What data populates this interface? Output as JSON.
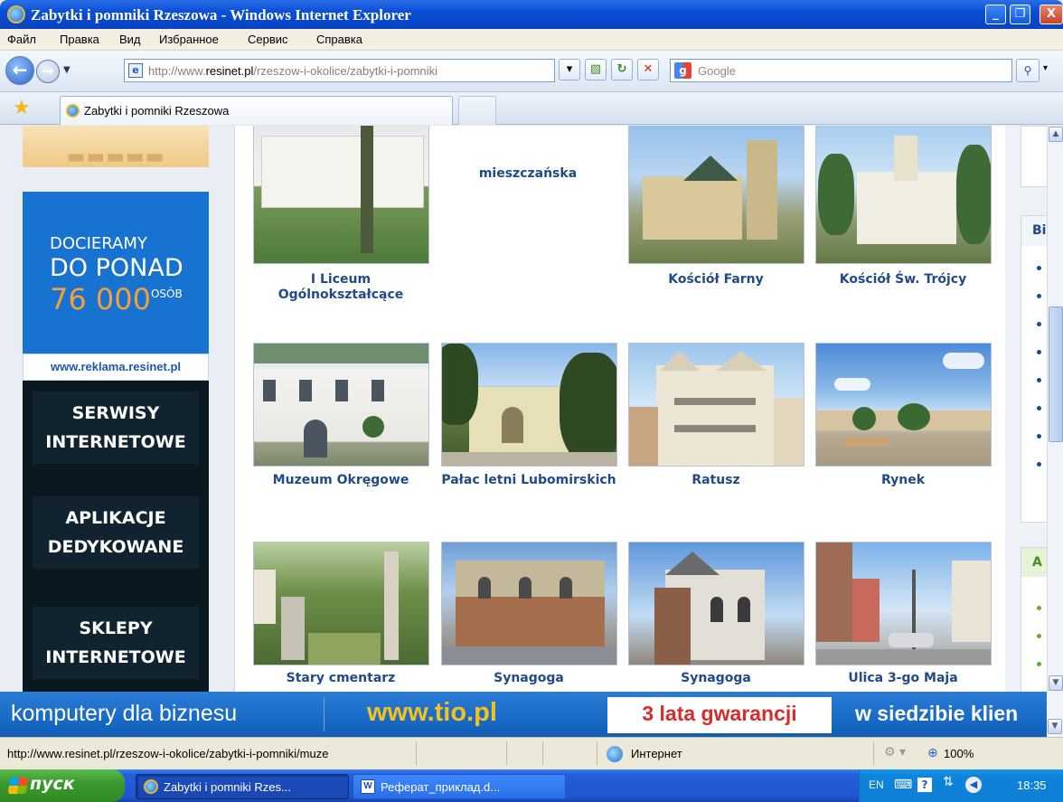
{
  "window": {
    "title": "Zabytki i pomniki Rzeszowa - Windows Internet Explorer",
    "min_label": "_",
    "max_label": "❐",
    "close_label": "X"
  },
  "menu": [
    "Файл",
    "Правка",
    "Вид",
    "Избранное",
    "Сервис",
    "Справка"
  ],
  "address": {
    "prefix": "http://www.",
    "domain": "resinet.pl",
    "path": "/rzeszow-i-okolice/zabytki-i-pomniki",
    "search_placeholder": "Google"
  },
  "tabs": {
    "active_label": "Zabytki i pomniki Rzeszowa"
  },
  "left_ads": {
    "blue_line1": "DOCIERAMY",
    "blue_line2": "DO PONAD",
    "blue_line3": "76 000",
    "blue_line3_suffix": "OSÓB",
    "url": "www.reklama.resinet.pl",
    "dark_buttons": [
      "SERWISY INTERNETOWE",
      "APLIKACJE DEDYKOWANE",
      "SKLEPY INTERNETOWE"
    ]
  },
  "gallery": {
    "row0": [
      "I Liceum Ogólnokształcące",
      "mieszczańska",
      "Kościół Farny",
      "Kościół Św. Trójcy"
    ],
    "row1": [
      "Muzeum Okręgowe",
      "Pałac letni Lubomirskich",
      "Ratusz",
      "Rynek"
    ],
    "row2": [
      "Stary cmentarz",
      "Synagoga",
      "Synagoga",
      "Ulica 3-go Maja"
    ]
  },
  "right_col": {
    "head2": "Bi",
    "head3": "A"
  },
  "banner": {
    "text1": "komputery dla biznesu",
    "text2": "www.tio.pl",
    "text3": "3 lata gwarancji",
    "text4": "w siedzibie klien"
  },
  "status": {
    "url": "http://www.resinet.pl/rzeszow-i-okolice/zabytki-i-pomniki/muze",
    "zone": "Интернет",
    "zoom": "100%"
  },
  "taskbar": {
    "start": "пуск",
    "task_ie": "Zabytki i pomniki Rzes...",
    "task_word": "Реферат_приклад.d...",
    "lang": "EN",
    "clock": "18:35"
  },
  "colors": {
    "caption": "#214a8a",
    "banner": "#1467c6",
    "ad_blue": "#1772d0"
  }
}
